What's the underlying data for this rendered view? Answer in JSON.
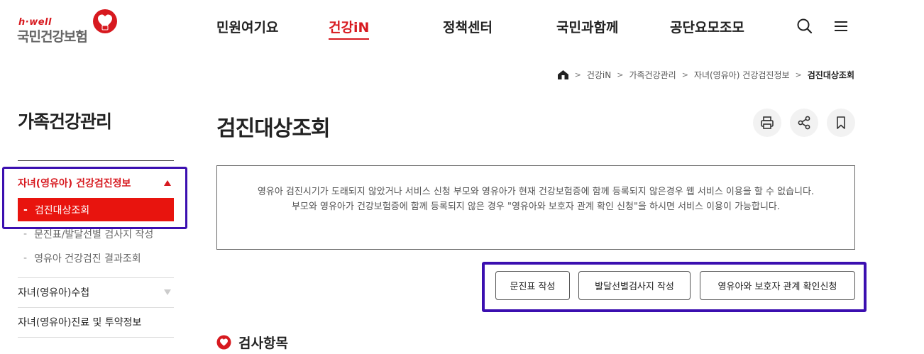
{
  "header": {
    "logo_small": "h·well",
    "logo_main": "국민건강보험",
    "nav": [
      {
        "label": "민원여기요"
      },
      {
        "label": "건강iN",
        "active": true
      },
      {
        "label": "정책센터"
      },
      {
        "label": "국민과함께"
      },
      {
        "label": "공단요모조모"
      }
    ],
    "icons": [
      "search-icon",
      "menu-icon"
    ]
  },
  "breadcrumb": {
    "items": [
      "건강iN",
      "가족건강관리",
      "자녀(영유아) 건강검진정보"
    ],
    "current": "검진대상조회"
  },
  "sidebar": {
    "title": "가족건강관리",
    "active_group": "자녀(영유아) 건강검진정보",
    "current_item": "검진대상조회",
    "sub_items": [
      "문진표/발달선별 검사지 작성",
      "영유아 건강검진 결과조회"
    ],
    "groups": [
      "자녀(영유아)수첩",
      "자녀(영유아)진료 및 투약정보"
    ]
  },
  "main": {
    "title": "검진대상조회",
    "tools": [
      "print-icon",
      "share-icon",
      "bookmark-icon"
    ],
    "notice_line1": "영유아 검진시기가 도래되지 않았거나 서비스 신청 부모와 영유아가 현재 건강보험증에 함께 등록되지 않은경우 웹 서비스 이용을 할 수 없습니다.",
    "notice_line2": "부모와 영유아가 건강보험증에 함께 등록되지 않은 경우 \"영유아와 보호자 관계 확인 신청\"을 하시면 서비스 이용이 가능합니다.",
    "buttons": [
      "문진표 작성",
      "발달선별검사지 작성",
      "영유아와 보호자 관계 확인신청"
    ],
    "section_title": "검사항목"
  },
  "colors": {
    "brand_red": "#d7191f",
    "active_bg": "#e8140e",
    "highlight": "#3b0fb0"
  }
}
